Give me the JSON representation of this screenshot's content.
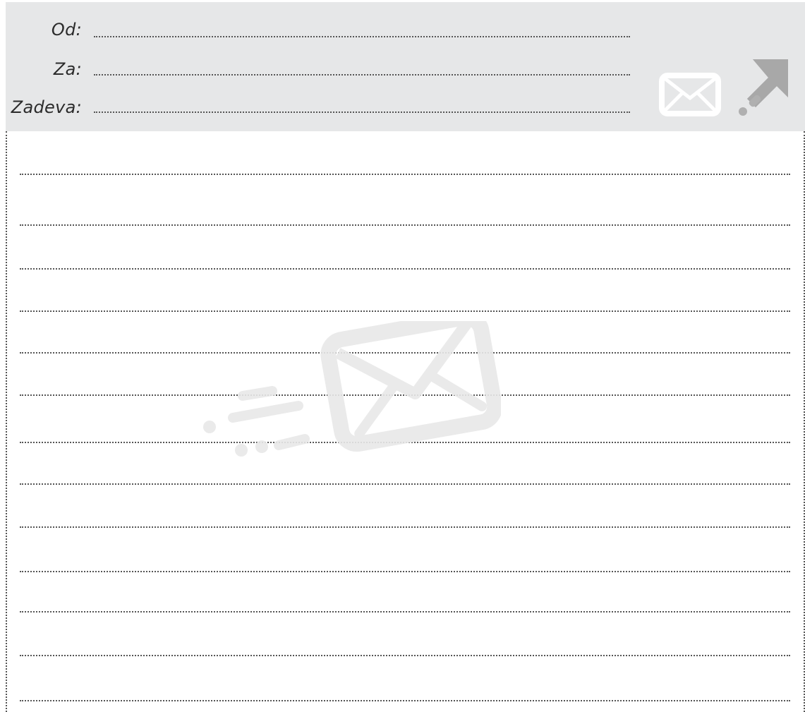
{
  "header": {
    "fields": [
      {
        "label": "Od:"
      },
      {
        "label": "Za:"
      },
      {
        "label": "Zadeva:"
      }
    ],
    "background_color": "#e6e7e8"
  },
  "icons": {
    "header_mail": "envelope-icon",
    "header_arrow": "send-arrow-icon",
    "watermark": "flying-envelope-icon"
  },
  "body": {
    "line_count": 13
  }
}
